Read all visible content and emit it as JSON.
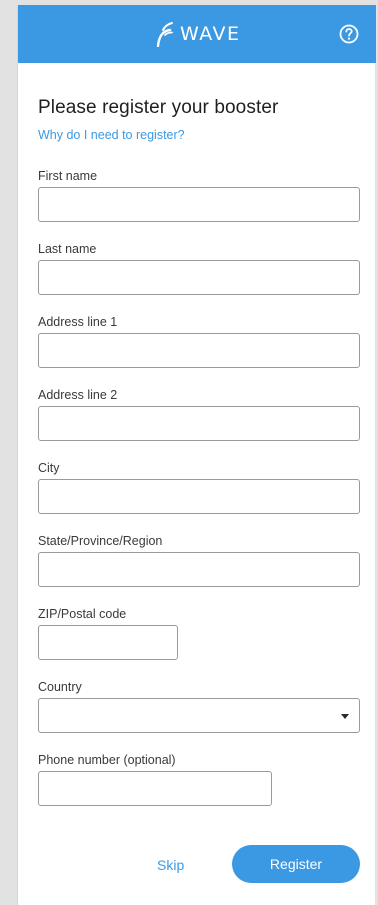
{
  "header": {
    "logo_text": "WAVE",
    "brand_color": "#3b99e3",
    "help_icon": "question-circle-icon"
  },
  "form": {
    "title": "Please register your booster",
    "why_link": "Why do I need to register?",
    "fields": {
      "first_name": {
        "label": "First name",
        "value": ""
      },
      "last_name": {
        "label": "Last name",
        "value": ""
      },
      "address1": {
        "label": "Address line 1",
        "value": ""
      },
      "address2": {
        "label": "Address line 2",
        "value": ""
      },
      "city": {
        "label": "City",
        "value": ""
      },
      "state": {
        "label": "State/Province/Region",
        "value": ""
      },
      "zip": {
        "label": "ZIP/Postal code",
        "value": ""
      },
      "country": {
        "label": "Country",
        "value": ""
      },
      "phone": {
        "label": "Phone number  (optional)",
        "value": ""
      }
    }
  },
  "actions": {
    "skip": "Skip",
    "register": "Register"
  }
}
